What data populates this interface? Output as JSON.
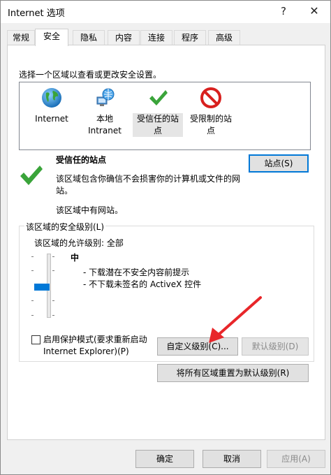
{
  "window": {
    "title": "Internet 选项",
    "help_label": "?",
    "close_label": "✕"
  },
  "tabs": [
    {
      "label": "常规"
    },
    {
      "label": "安全"
    },
    {
      "label": "隐私"
    },
    {
      "label": "内容"
    },
    {
      "label": "连接"
    },
    {
      "label": "程序"
    },
    {
      "label": "高级"
    }
  ],
  "active_tab": "安全",
  "zones_intro": "选择一个区域以查看或更改安全设置。",
  "zones": [
    {
      "label": "Internet",
      "icon": "globe-icon"
    },
    {
      "label": "本地\nIntranet",
      "icon": "intranet-icon"
    },
    {
      "label": "受信任的站\n点",
      "icon": "check-icon",
      "selected": true
    },
    {
      "label": "受限制的站\n点",
      "icon": "restricted-icon"
    }
  ],
  "selected_zone": {
    "title": "受信任的站点",
    "description": "该区域包含你确信不会损害你的计算机或文件的网站。",
    "note": "该区域中有网站。",
    "sites_button": "站点(S)"
  },
  "security_level": {
    "group_label": "该区域的安全级别(L)",
    "allowed_label": "该区域的允许级别: 全部",
    "level_name": "中",
    "level_points": [
      "- 下载潜在不安全内容前提示",
      "- 不下载未签名的 ActiveX 控件"
    ],
    "protected_mode_label": "启用保护模式(要求重新启动\nInternet Explorer)(P)",
    "protected_mode_checked": false,
    "custom_button": "自定义级别(C)...",
    "default_button": "默认级别(D)",
    "reset_all_button": "将所有区域重置为默认级别(R)"
  },
  "footer": {
    "ok": "确定",
    "cancel": "取消",
    "apply": "应用(A)"
  },
  "colors": {
    "accent": "#0078d7",
    "arrow": "#e8262a",
    "check": "#3aa43a",
    "restricted": "#d8201e"
  }
}
